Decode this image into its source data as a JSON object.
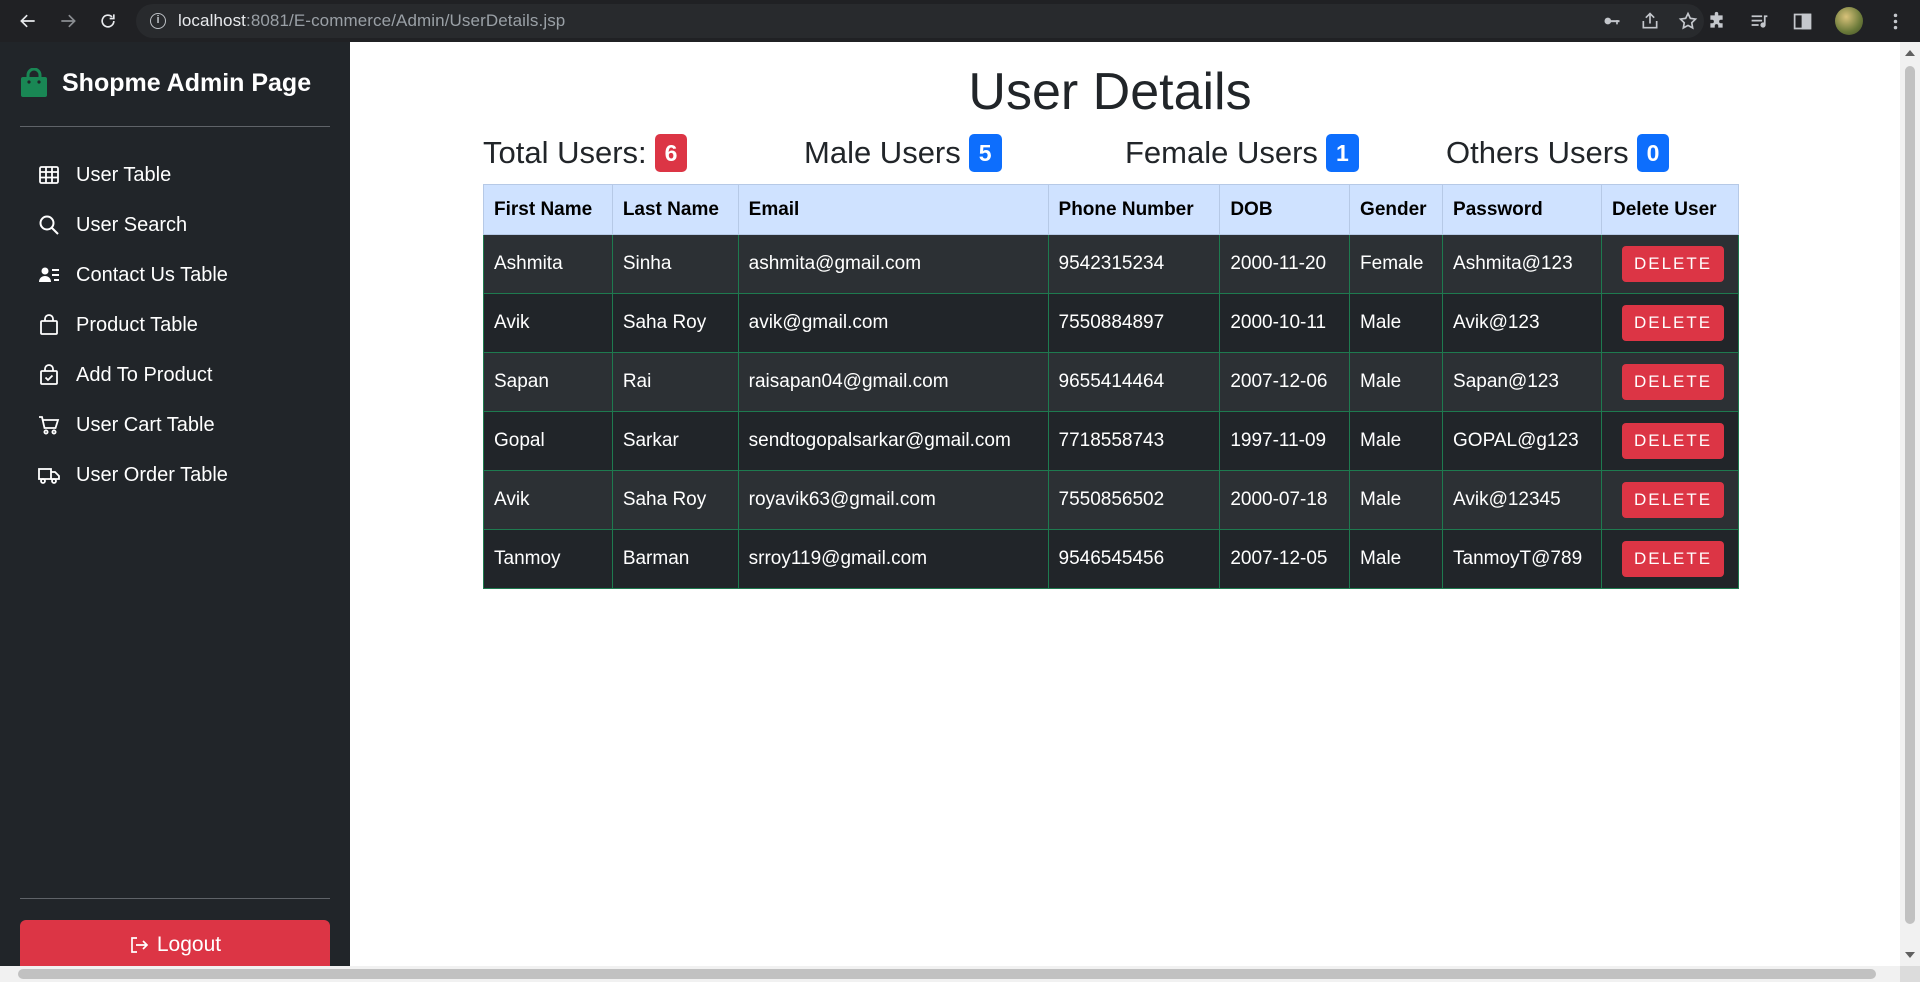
{
  "browser": {
    "url_host": "localhost",
    "url_rest": ":8081/E-commerce/Admin/UserDetails.jsp"
  },
  "sidebar": {
    "brand": "Shopme Admin Page",
    "items": [
      {
        "label": "User Table",
        "icon": "table-icon"
      },
      {
        "label": "User Search",
        "icon": "search-icon"
      },
      {
        "label": "Contact Us Table",
        "icon": "contact-card-icon"
      },
      {
        "label": "Product Table",
        "icon": "shopping-bag-icon"
      },
      {
        "label": "Add To Product",
        "icon": "bag-check-icon"
      },
      {
        "label": "User Cart Table",
        "icon": "cart-icon"
      },
      {
        "label": "User Order Table",
        "icon": "truck-icon"
      }
    ],
    "logout": "Logout"
  },
  "main": {
    "title": "User Details",
    "stats": [
      {
        "label": "Total Users:",
        "value": "6",
        "color": "#dc3545"
      },
      {
        "label": "Male Users",
        "value": "5",
        "color": "#0d6efd"
      },
      {
        "label": "Female Users",
        "value": "1",
        "color": "#0d6efd"
      },
      {
        "label": "Others Users",
        "value": "0",
        "color": "#0d6efd"
      }
    ],
    "table": {
      "headers": [
        "First Name",
        "Last Name",
        "Email",
        "Phone Number",
        "DOB",
        "Gender",
        "Password",
        "Delete User"
      ],
      "delete_label": "DELETE",
      "rows": [
        [
          "Ashmita",
          "Sinha",
          "ashmita@gmail.com",
          "9542315234",
          "2000-11-20",
          "Female",
          "Ashmita@123"
        ],
        [
          "Avik",
          "Saha Roy",
          "avik@gmail.com",
          "7550884897",
          "2000-10-11",
          "Male",
          "Avik@123"
        ],
        [
          "Sapan",
          "Rai",
          "raisapan04@gmail.com",
          "9655414464",
          "2007-12-06",
          "Male",
          "Sapan@123"
        ],
        [
          "Gopal",
          "Sarkar",
          "sendtogopalsarkar@gmail.com",
          "7718558743",
          "1997-11-09",
          "Male",
          "GOPAL@g123"
        ],
        [
          "Avik",
          "Saha Roy",
          "royavik63@gmail.com",
          "7550856502",
          "2000-07-18",
          "Male",
          "Avik@12345"
        ],
        [
          "Tanmoy",
          "Barman",
          "srroy119@gmail.com",
          "9546545456",
          "2007-12-05",
          "Male",
          "TanmoyT@789"
        ]
      ]
    }
  }
}
